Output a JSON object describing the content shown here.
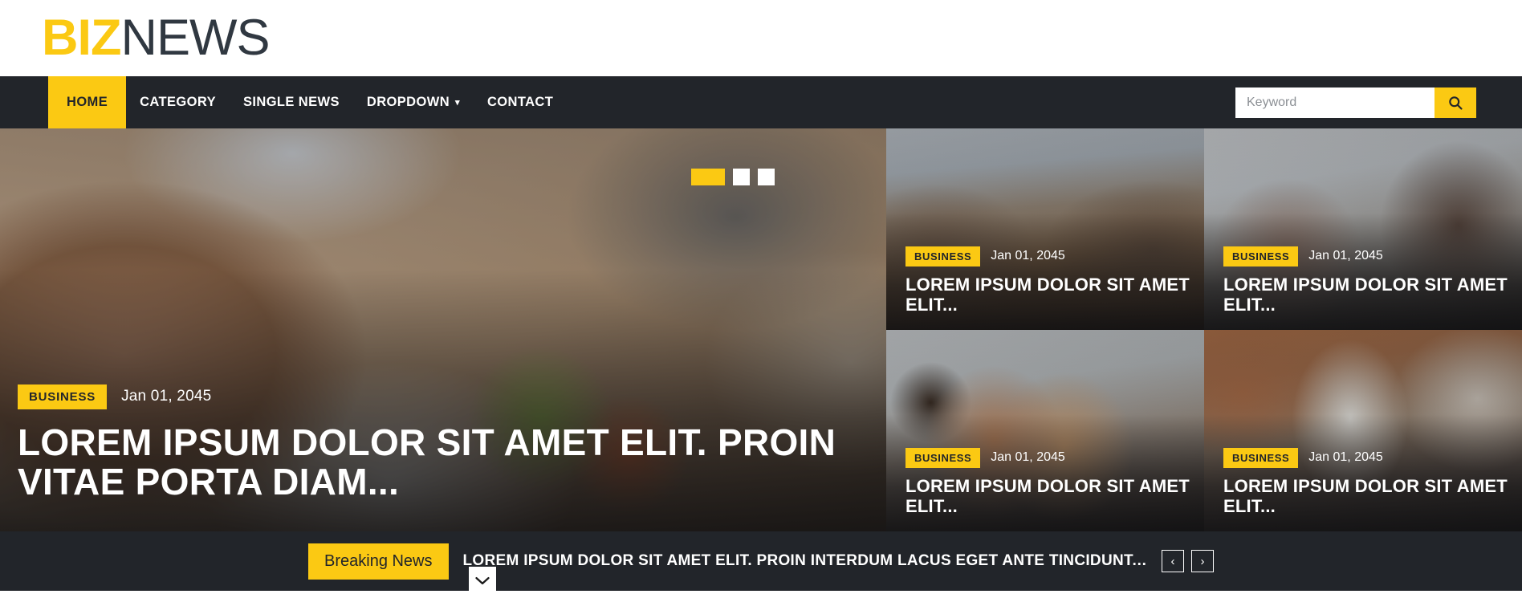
{
  "brand": {
    "part1": "BIZ",
    "part2": "NEWS"
  },
  "nav": {
    "items": [
      {
        "label": "HOME",
        "active": true,
        "caret": false
      },
      {
        "label": "CATEGORY",
        "active": false,
        "caret": false
      },
      {
        "label": "SINGLE NEWS",
        "active": false,
        "caret": false
      },
      {
        "label": "DROPDOWN",
        "active": false,
        "caret": true
      },
      {
        "label": "CONTACT",
        "active": false,
        "caret": false
      }
    ],
    "caret_glyph": "▾"
  },
  "search": {
    "placeholder": "Keyword",
    "value": "",
    "icon": "search-icon"
  },
  "hero": {
    "badge": "BUSINESS",
    "date": "Jan 01, 2045",
    "title": "LOREM IPSUM DOLOR SIT AMET ELIT. PROIN VITAE PORTA DIAM...",
    "indicators": [
      {
        "active": true
      },
      {
        "active": false
      },
      {
        "active": false
      }
    ]
  },
  "thumbnails": [
    {
      "badge": "BUSINESS",
      "date": "Jan 01, 2045",
      "title": "LOREM IPSUM DOLOR SIT AMET ELIT...",
      "art": "img-meeting"
    },
    {
      "badge": "BUSINESS",
      "date": "Jan 01, 2045",
      "title": "LOREM IPSUM DOLOR SIT AMET ELIT...",
      "art": "img-office"
    },
    {
      "badge": "BUSINESS",
      "date": "Jan 01, 2045",
      "title": "LOREM IPSUM DOLOR SIT AMET ELIT...",
      "art": "img-casual"
    },
    {
      "badge": "BUSINESS",
      "date": "Jan 01, 2045",
      "title": "LOREM IPSUM DOLOR SIT AMET ELIT...",
      "art": "img-whiteboard"
    }
  ],
  "breaking": {
    "badge": "Breaking News",
    "text": "LOREM IPSUM DOLOR SIT AMET ELIT. PROIN INTERDUM LACUS EGET ANTE TINCIDUNT, SED FAU...",
    "prev": "‹",
    "next": "›",
    "chevron": "⌄"
  },
  "colors": {
    "accent": "#FBC913",
    "dark": "#22252A",
    "logo_dark": "#303841",
    "white": "#FFFFFF"
  }
}
